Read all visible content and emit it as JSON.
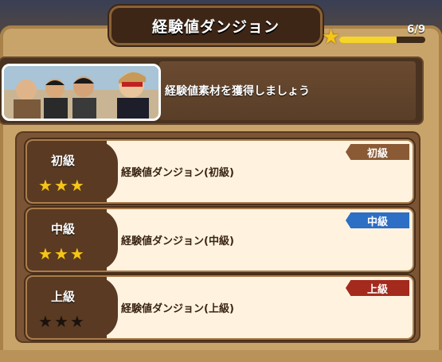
{
  "header": {
    "title": "経験値ダンジョン",
    "progress_text": "6/9",
    "progress_fraction": 0.67
  },
  "banner": {
    "text": "経験値素材を獲得しましょう"
  },
  "dungeons": [
    {
      "level": "初級",
      "title": "経験値ダンジョン(初級)",
      "tag": "初級",
      "tag_color": "#8a5a34",
      "stars_on": 3
    },
    {
      "level": "中級",
      "title": "経験値ダンジョン(中級)",
      "tag": "中級",
      "tag_color": "#2d6fc4",
      "stars_on": 3
    },
    {
      "level": "上級",
      "title": "経験値ダンジョン(上級)",
      "tag": "上級",
      "tag_color": "#a42a1e",
      "stars_on": 0
    }
  ],
  "icons": {
    "star": "star-icon"
  }
}
